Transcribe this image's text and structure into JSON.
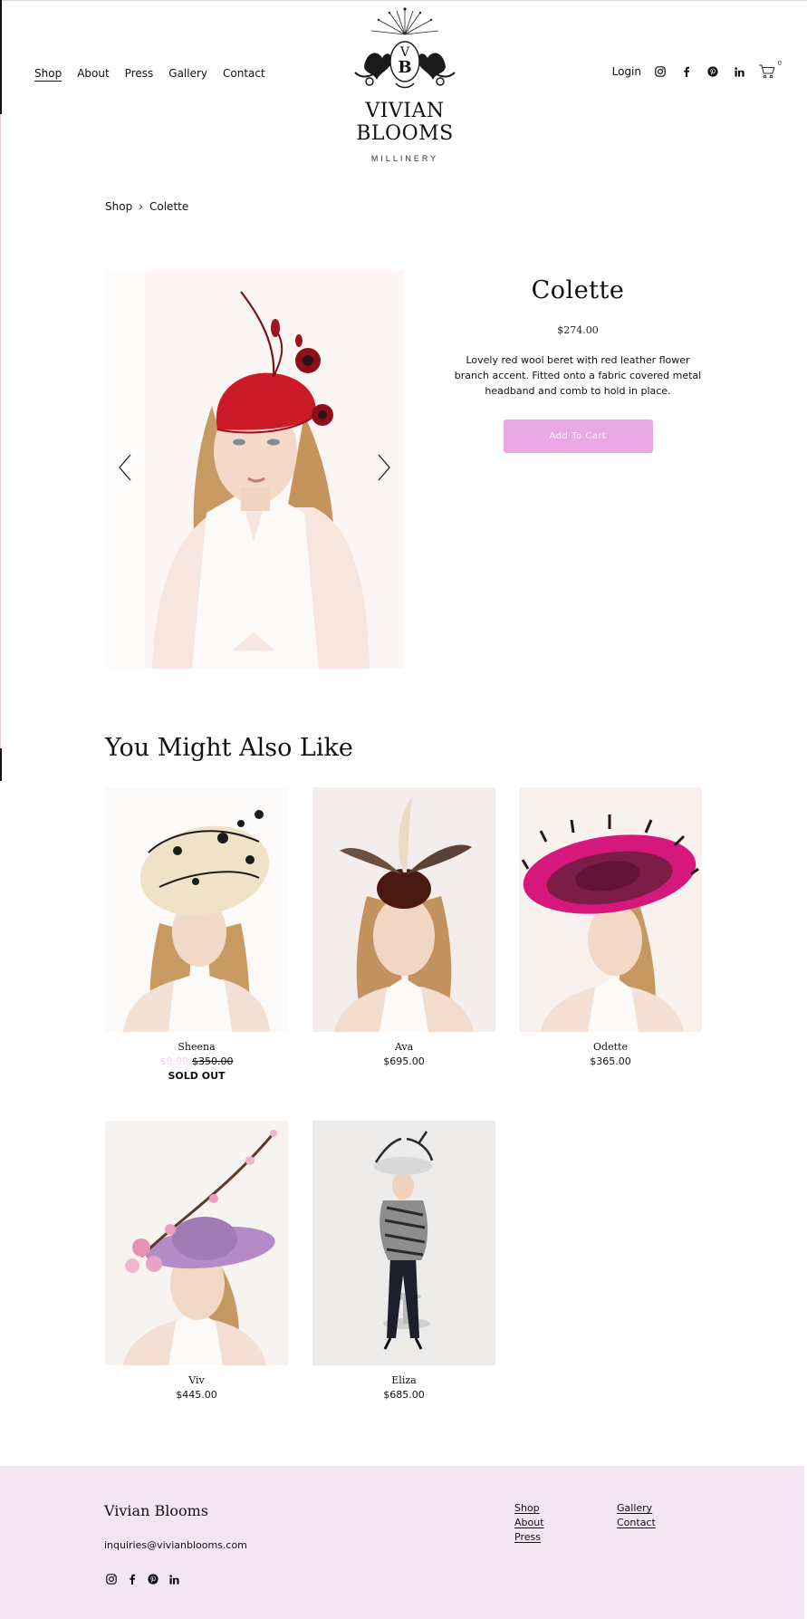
{
  "header": {
    "nav_left": [
      "Shop",
      "About",
      "Press",
      "Gallery",
      "Contact"
    ],
    "active_nav": "Shop",
    "logo": {
      "monogram": "VB",
      "brand": "VIVIAN BLOOMS",
      "sub": "MILLINERY"
    },
    "login": "Login",
    "social_icons": [
      "instagram-icon",
      "facebook-icon",
      "pinterest-icon",
      "linkedin-icon"
    ],
    "cart_count": "0"
  },
  "breadcrumb": {
    "parent": "Shop",
    "separator": "›",
    "current": "Colette"
  },
  "product": {
    "title": "Colette",
    "price": "$274.00",
    "description": "Lovely red wool beret with red leather flower branch accent. Fitted onto a fabric covered metal headband and comb to hold in place.",
    "add_to_cart": "Add To Cart"
  },
  "related": {
    "title": "You Might Also Like",
    "items": [
      {
        "name": "Sheena",
        "sale_price": "$0.00",
        "old_price": "$350.00",
        "status": "SOLD OUT"
      },
      {
        "name": "Ava",
        "price": "$695.00"
      },
      {
        "name": "Odette",
        "price": "$365.00"
      },
      {
        "name": "Viv",
        "price": "$445.00"
      },
      {
        "name": "Eliza",
        "price": "$685.00"
      }
    ]
  },
  "footer": {
    "brand": "Vivian Blooms",
    "email": "inquiries@vivianblooms.com",
    "col1": [
      "Shop",
      "About",
      "Press"
    ],
    "col2": [
      "Gallery",
      "Contact"
    ]
  },
  "colors": {
    "accent": "#eaa9e4",
    "footer_bg": "#f5e4f4"
  }
}
